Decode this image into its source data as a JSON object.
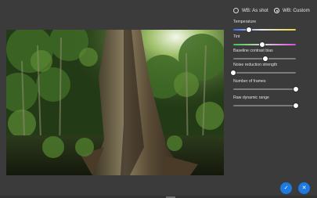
{
  "white_balance": {
    "options": [
      {
        "label": "WB: As shot",
        "selected": false
      },
      {
        "label": "WB: Custom",
        "selected": true
      }
    ]
  },
  "controls": [
    {
      "label": "Temperature",
      "value": 0.25
    },
    {
      "label": "Tint",
      "value": 0.46
    },
    {
      "label": "Baseline contrast bias",
      "value": 0.51
    },
    {
      "label": "Noise reduction strength",
      "value": 0.0
    },
    {
      "label": "Number of frames",
      "value": 1.0
    },
    {
      "label": "Raw dynamic range",
      "value": 1.0
    }
  ],
  "actions": {
    "confirm_icon": "✓",
    "cancel_icon": "✕"
  },
  "colors": {
    "accent": "#1f7ae0",
    "background": "#3b3b3b"
  }
}
